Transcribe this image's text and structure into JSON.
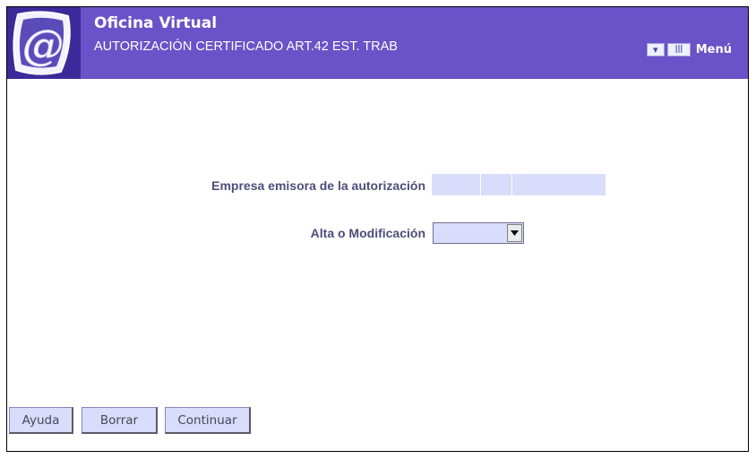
{
  "header": {
    "app_title": "Oficina Virtual",
    "subtitle": "AUTORIZACIÓN CERTIFICADO ART.42 EST. TRAB",
    "menu_label": "Menú",
    "menu_icons": [
      "arrow-down-icon",
      "grid-icon"
    ]
  },
  "form": {
    "empresa_label": "Empresa emisora de la autorización",
    "empresa_value": [
      "",
      "",
      ""
    ],
    "alta_label": "Alta o Modificación",
    "alta_selected": ""
  },
  "buttons": {
    "ayuda": "Ayuda",
    "borrar": "Borrar",
    "continuar": "Continuar"
  },
  "colors": {
    "header_bg": "#6a52c8",
    "logo_bg": "#3c2a9a",
    "field_bg": "#d9dcfa",
    "label_text": "#4d4d7a"
  }
}
